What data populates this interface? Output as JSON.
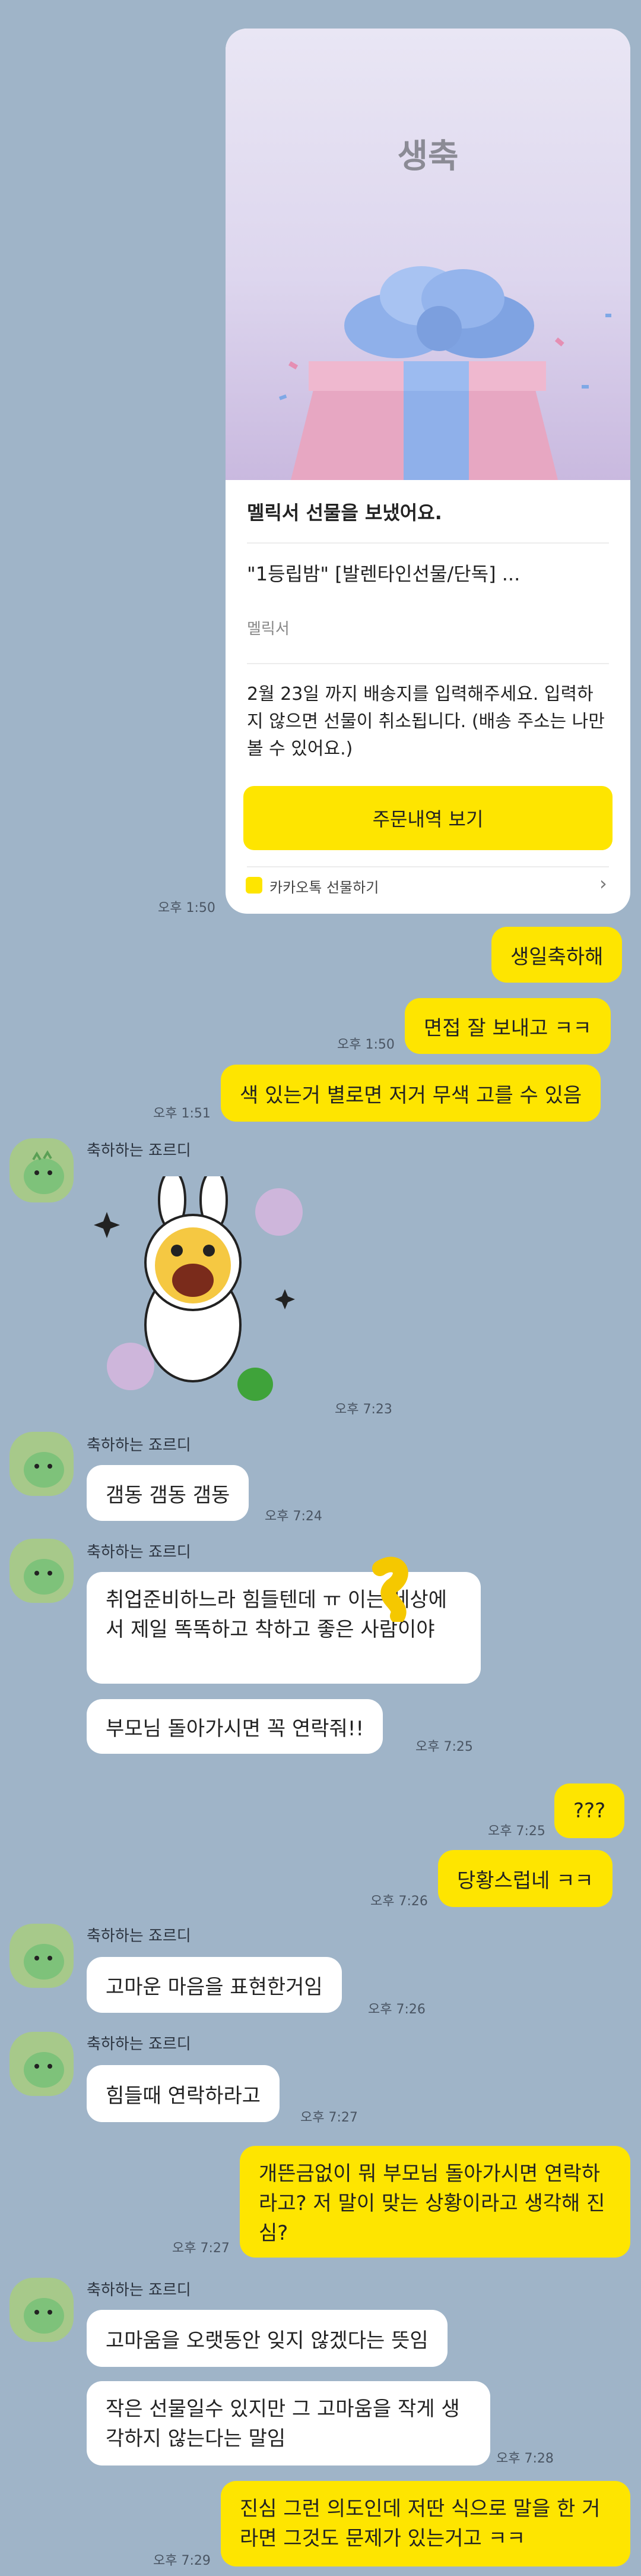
{
  "gift": {
    "title": "생축",
    "sent_text": "멜릭서 선물을 보냈어요.",
    "product_name": "\"1등립밤\" [발렌타인선물/단독] ...",
    "brand": "멜릭서",
    "notice": "2월 23일 까지 배송지를 입력해주세요. 입력하지 않으면 선물이 취소됩니다. (배송 주소는 나만 볼 수 있어요.)",
    "order_button": "주문내역 보기",
    "footer_label": "카카오톡 선물하기",
    "time": "오후 1:50"
  },
  "messages_me_1": {
    "text": "생일축하해"
  },
  "messages_me_2": {
    "text": "면접 잘 보내고 ㅋㅋ",
    "time": "오후 1:50"
  },
  "messages_me_3": {
    "text": "색 있는거 별로면 저거 무색 고를 수 있음",
    "time": "오후 1:51"
  },
  "sender_name": "축하하는 죠르디",
  "emoticon_time": "오후 7:23",
  "you_1": {
    "text": "갬동 갬동 갬동",
    "time": "오후 7:24"
  },
  "you_2": {
    "text": "취업준비하느라 힘들텐데 ㅠ    이는 세상에서 제일 똑똑하고 착하고 좋은 사람이야"
  },
  "you_3": {
    "text": "부모님 돌아가시면 꼭 연락줘!!",
    "time": "오후 7:25"
  },
  "me_4": {
    "text": "???",
    "time": "오후 7:25"
  },
  "me_5": {
    "text": "당황스럽네 ㅋㅋ",
    "time": "오후 7:26"
  },
  "you_4": {
    "text": "고마운 마음을 표현한거임",
    "time": "오후 7:26"
  },
  "you_5": {
    "text": "힘들때 연락하라고",
    "time": "오후 7:27"
  },
  "me_6": {
    "text": "개뜬금없이 뭐 부모님 돌아가시면 연락하라고? 저 말이 맞는 상황이라고 생각해 진심?",
    "time": "오후 7:27"
  },
  "you_6": {
    "text": "고마움을 오랫동안 잊지 않겠다는 뜻임"
  },
  "you_7": {
    "text": "작은 선물일수 있지만 그 고마움을 작게 생각하지 않는다는 말임",
    "time": "오후 7:28"
  },
  "me_7": {
    "text": "진심 그런 의도인데 저딴 식으로 말을 한 거라면 그것도 문제가 있는거고 ㅋㅋ",
    "time": "오후 7:29"
  },
  "colors": {
    "background": "#9fb4c8",
    "bubble_me": "#fee500",
    "bubble_you": "#ffffff"
  }
}
